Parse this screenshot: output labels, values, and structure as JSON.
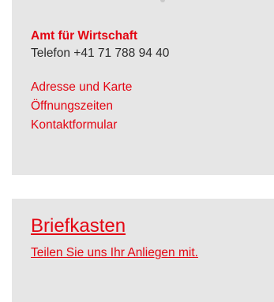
{
  "contact": {
    "department": "Amt für Wirtschaft",
    "phone": "Telefon +41 71 788 94 40",
    "links": [
      {
        "label": "Adresse und Karte"
      },
      {
        "label": "Öffnungszeiten"
      },
      {
        "label": "Kontaktformular"
      }
    ]
  },
  "briefkasten": {
    "title": "Briefkasten",
    "subtitle": "Teilen Sie uns Ihr Anliegen mit."
  },
  "colors": {
    "accent": "#e30613",
    "card_background": "#e6e6e6",
    "text": "#2b2b2b"
  }
}
